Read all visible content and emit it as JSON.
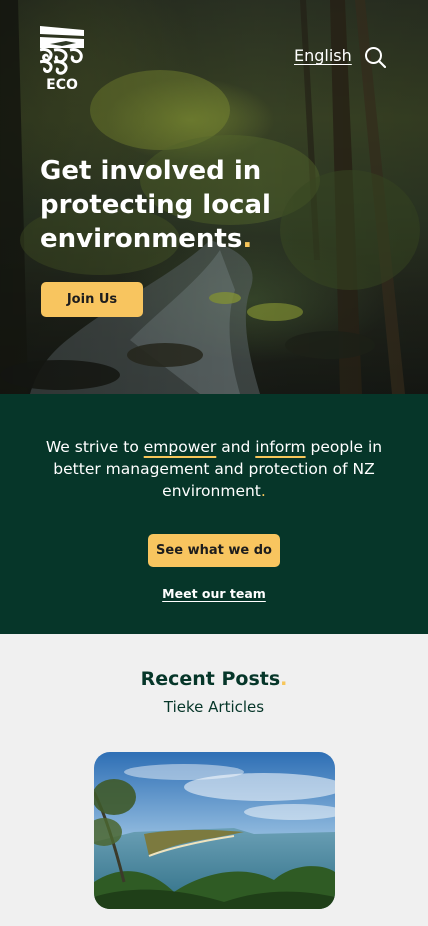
{
  "header": {
    "logo_text": "ECO",
    "language_label": "English",
    "search_icon": "search-icon"
  },
  "hero": {
    "title": "Get involved in protecting local environments",
    "title_dot": ".",
    "join_button": "Join Us"
  },
  "mission": {
    "text_part1": "We strive to ",
    "link_empower": "empower",
    "text_part2": " and ",
    "link_inform": "inform",
    "text_part3": " people in better management and protection of NZ environment",
    "text_dot": ".",
    "see_button": "See what we do",
    "team_link": "Meet our team"
  },
  "recent": {
    "title": "Recent Posts",
    "title_dot": ".",
    "subtitle": "Tieke Articles"
  },
  "colors": {
    "accent_yellow": "#f8c55f",
    "dark_green": "#063629",
    "background": "#f0f0f0"
  }
}
